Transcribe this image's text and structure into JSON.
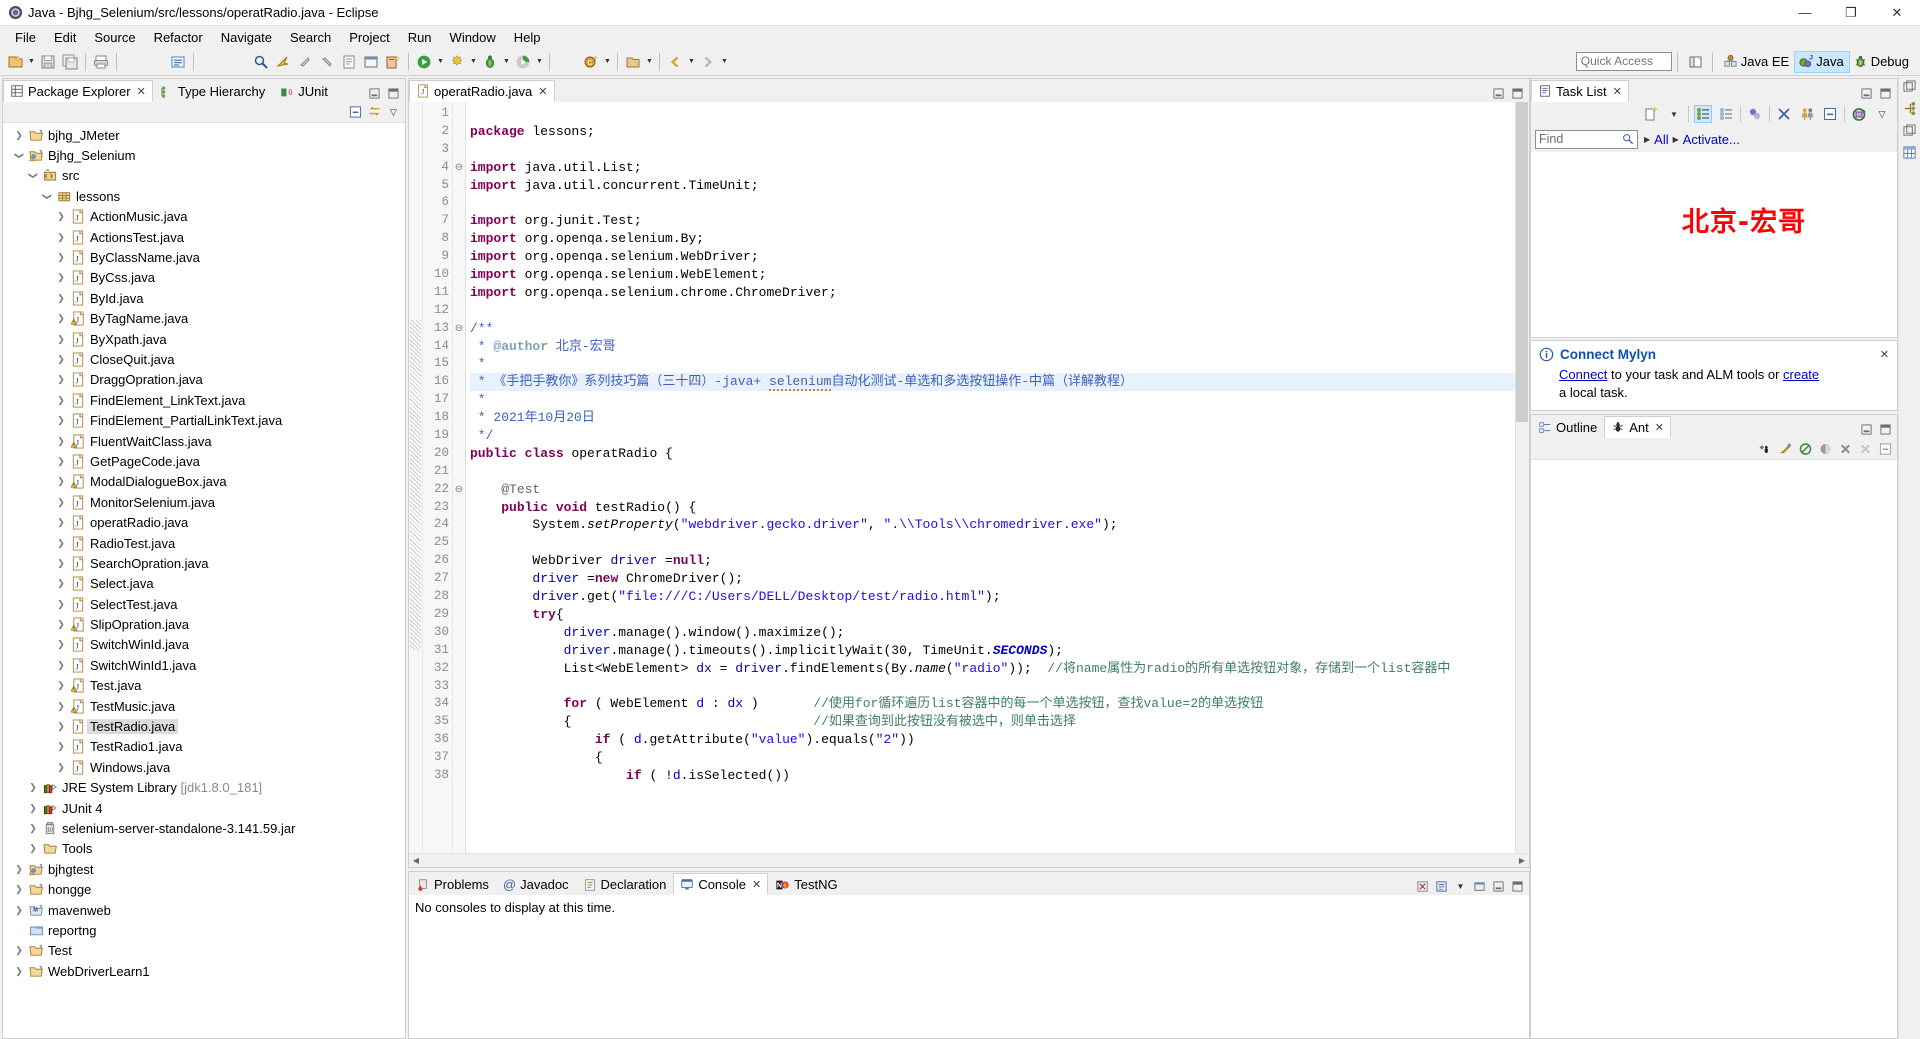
{
  "window": {
    "title": "Java - Bjhg_Selenium/src/lessons/operatRadio.java - Eclipse",
    "minimize": "—",
    "maximize": "❐",
    "close": "✕"
  },
  "menubar": {
    "items": [
      "File",
      "Edit",
      "Source",
      "Refactor",
      "Navigate",
      "Search",
      "Project",
      "Run",
      "Window",
      "Help"
    ]
  },
  "toolbar": {
    "quick_access_placeholder": "Quick Access",
    "perspectives": [
      {
        "label": "Java EE",
        "active": false
      },
      {
        "label": "Java",
        "active": true
      },
      {
        "label": "Debug",
        "active": false
      }
    ]
  },
  "package_explorer": {
    "tabs": [
      {
        "label": "Package Explorer",
        "active": true,
        "closable": true
      },
      {
        "label": "Type Hierarchy",
        "active": false,
        "closable": false
      },
      {
        "label": "JUnit",
        "active": false,
        "closable": false
      }
    ],
    "toolbar_icons": [
      "collapse-all-icon",
      "link-with-editor-icon"
    ],
    "view_menu": "▽",
    "minimize": "—",
    "maximize": "❐",
    "tree": [
      {
        "depth": 0,
        "twisty": "collapsed",
        "icon": "project-closed",
        "label": "bjhg_JMeter"
      },
      {
        "depth": 0,
        "twisty": "expanded",
        "icon": "project-java-warn",
        "label": "Bjhg_Selenium"
      },
      {
        "depth": 1,
        "twisty": "expanded",
        "icon": "source-folder",
        "label": "src"
      },
      {
        "depth": 2,
        "twisty": "expanded",
        "icon": "package",
        "label": "lessons"
      },
      {
        "depth": 3,
        "twisty": "collapsed",
        "icon": "java-file",
        "label": "ActionMusic.java"
      },
      {
        "depth": 3,
        "twisty": "collapsed",
        "icon": "java-file",
        "label": "ActionsTest.java"
      },
      {
        "depth": 3,
        "twisty": "collapsed",
        "icon": "java-file",
        "label": "ByClassName.java"
      },
      {
        "depth": 3,
        "twisty": "collapsed",
        "icon": "java-file",
        "label": "ByCss.java"
      },
      {
        "depth": 3,
        "twisty": "collapsed",
        "icon": "java-file",
        "label": "ById.java"
      },
      {
        "depth": 3,
        "twisty": "collapsed",
        "icon": "java-file-warn",
        "label": "ByTagName.java"
      },
      {
        "depth": 3,
        "twisty": "collapsed",
        "icon": "java-file",
        "label": "ByXpath.java"
      },
      {
        "depth": 3,
        "twisty": "collapsed",
        "icon": "java-file",
        "label": "CloseQuit.java"
      },
      {
        "depth": 3,
        "twisty": "collapsed",
        "icon": "java-file",
        "label": "DraggOpration.java"
      },
      {
        "depth": 3,
        "twisty": "collapsed",
        "icon": "java-file",
        "label": "FindElement_LinkText.java"
      },
      {
        "depth": 3,
        "twisty": "collapsed",
        "icon": "java-file",
        "label": "FindElement_PartialLinkText.java"
      },
      {
        "depth": 3,
        "twisty": "collapsed",
        "icon": "java-file-warn",
        "label": "FluentWaitClass.java"
      },
      {
        "depth": 3,
        "twisty": "collapsed",
        "icon": "java-file",
        "label": "GetPageCode.java"
      },
      {
        "depth": 3,
        "twisty": "collapsed",
        "icon": "java-file-warn",
        "label": "ModalDialogueBox.java"
      },
      {
        "depth": 3,
        "twisty": "collapsed",
        "icon": "java-file",
        "label": "MonitorSelenium.java"
      },
      {
        "depth": 3,
        "twisty": "collapsed",
        "icon": "java-file",
        "label": "operatRadio.java"
      },
      {
        "depth": 3,
        "twisty": "collapsed",
        "icon": "java-file",
        "label": "RadioTest.java"
      },
      {
        "depth": 3,
        "twisty": "collapsed",
        "icon": "java-file",
        "label": "SearchOpration.java"
      },
      {
        "depth": 3,
        "twisty": "collapsed",
        "icon": "java-file",
        "label": "Select.java"
      },
      {
        "depth": 3,
        "twisty": "collapsed",
        "icon": "java-file",
        "label": "SelectTest.java"
      },
      {
        "depth": 3,
        "twisty": "collapsed",
        "icon": "java-file-warn",
        "label": "SlipOpration.java"
      },
      {
        "depth": 3,
        "twisty": "collapsed",
        "icon": "java-file",
        "label": "SwitchWinId.java"
      },
      {
        "depth": 3,
        "twisty": "collapsed",
        "icon": "java-file",
        "label": "SwitchWinId1.java"
      },
      {
        "depth": 3,
        "twisty": "collapsed",
        "icon": "java-file-warn",
        "label": "Test.java"
      },
      {
        "depth": 3,
        "twisty": "collapsed",
        "icon": "java-file-warn",
        "label": "TestMusic.java"
      },
      {
        "depth": 3,
        "twisty": "collapsed",
        "icon": "java-file",
        "label": "TestRadio.java",
        "selected": true
      },
      {
        "depth": 3,
        "twisty": "collapsed",
        "icon": "java-file",
        "label": "TestRadio1.java"
      },
      {
        "depth": 3,
        "twisty": "collapsed",
        "icon": "java-file",
        "label": "Windows.java"
      },
      {
        "depth": 1,
        "twisty": "collapsed",
        "icon": "library",
        "label": "JRE System Library",
        "suffix": "[jdk1.8.0_181]"
      },
      {
        "depth": 1,
        "twisty": "collapsed",
        "icon": "library",
        "label": "JUnit 4"
      },
      {
        "depth": 1,
        "twisty": "collapsed",
        "icon": "jar",
        "label": "selenium-server-standalone-3.141.59.jar"
      },
      {
        "depth": 1,
        "twisty": "collapsed",
        "icon": "folder",
        "label": "Tools"
      },
      {
        "depth": 0,
        "twisty": "collapsed",
        "icon": "project-java-warn",
        "label": "bjhgtest"
      },
      {
        "depth": 0,
        "twisty": "collapsed",
        "icon": "project-closed",
        "label": "hongge"
      },
      {
        "depth": 0,
        "twisty": "collapsed",
        "icon": "project-maven",
        "label": "mavenweb"
      },
      {
        "depth": 0,
        "twisty": "none",
        "icon": "folder-plain",
        "label": "reportng"
      },
      {
        "depth": 0,
        "twisty": "collapsed",
        "icon": "project-closed",
        "label": "Test"
      },
      {
        "depth": 0,
        "twisty": "collapsed",
        "icon": "project-closed",
        "label": "WebDriverLearn1"
      }
    ]
  },
  "editor": {
    "tab": {
      "label": "operatRadio.java",
      "icon": "java-file",
      "close": "✕",
      "active": true
    },
    "minimize": "—",
    "maximize": "❐",
    "lines": [
      {
        "n": 1,
        "fold": "",
        "text": ""
      },
      {
        "n": 2,
        "fold": "",
        "text": "package lessons;"
      },
      {
        "n": 3,
        "fold": "",
        "text": ""
      },
      {
        "n": 4,
        "fold": "⊖",
        "text": "import java.util.List;"
      },
      {
        "n": 5,
        "fold": "",
        "text": "import java.util.concurrent.TimeUnit;"
      },
      {
        "n": 6,
        "fold": "",
        "text": ""
      },
      {
        "n": 7,
        "fold": "",
        "text": "import org.junit.Test;"
      },
      {
        "n": 8,
        "fold": "",
        "text": "import org.openqa.selenium.By;"
      },
      {
        "n": 9,
        "fold": "",
        "text": "import org.openqa.selenium.WebDriver;"
      },
      {
        "n": 10,
        "fold": "",
        "text": "import org.openqa.selenium.WebElement;"
      },
      {
        "n": 11,
        "fold": "",
        "text": "import org.openqa.selenium.chrome.ChromeDriver;"
      },
      {
        "n": 12,
        "fold": "",
        "text": ""
      },
      {
        "n": 13,
        "fold": "⊖",
        "text": "/**"
      },
      {
        "n": 14,
        "fold": "",
        "text": " * @author 北京-宏哥"
      },
      {
        "n": 15,
        "fold": "",
        "text": " *"
      },
      {
        "n": 16,
        "fold": "",
        "text": " * 《手把手教你》系列技巧篇（三十四）-java+ selenium自动化测试-单选和多选按钮操作-中篇（详解教程）",
        "highlight": true
      },
      {
        "n": 17,
        "fold": "",
        "text": " *"
      },
      {
        "n": 18,
        "fold": "",
        "text": " * 2021年10月20日"
      },
      {
        "n": 19,
        "fold": "",
        "text": " */"
      },
      {
        "n": 20,
        "fold": "",
        "text": "public class operatRadio {"
      },
      {
        "n": 21,
        "fold": "",
        "text": ""
      },
      {
        "n": 22,
        "fold": "⊖",
        "text": "    @Test"
      },
      {
        "n": 23,
        "fold": "",
        "text": "    public void testRadio() {"
      },
      {
        "n": 24,
        "fold": "",
        "text": "        System.setProperty(\"webdriver.gecko.driver\", \".\\\\Tools\\\\chromedriver.exe\");"
      },
      {
        "n": 25,
        "fold": "",
        "text": ""
      },
      {
        "n": 26,
        "fold": "",
        "text": "        WebDriver driver =null;"
      },
      {
        "n": 27,
        "fold": "",
        "text": "        driver =new ChromeDriver();"
      },
      {
        "n": 28,
        "fold": "",
        "text": "        driver.get(\"file:///C:/Users/DELL/Desktop/test/radio.html\");"
      },
      {
        "n": 29,
        "fold": "",
        "text": "        try{"
      },
      {
        "n": 30,
        "fold": "",
        "text": "            driver.manage().window().maximize();"
      },
      {
        "n": 31,
        "fold": "",
        "text": "            driver.manage().timeouts().implicitlyWait(30, TimeUnit.SECONDS);"
      },
      {
        "n": 32,
        "fold": "",
        "text": "            List<WebElement> dx = driver.findElements(By.name(\"radio\"));  //将name属性为radio的所有单选按钮对象，存储到一个list容器中"
      },
      {
        "n": 33,
        "fold": "",
        "text": ""
      },
      {
        "n": 34,
        "fold": "",
        "text": "            for ( WebElement d : dx )       //使用for循环遍历list容器中的每一个单选按钮，查找value=2的单选按钮"
      },
      {
        "n": 35,
        "fold": "",
        "text": "            {                               //如果查询到此按钮没有被选中，则单击选择"
      },
      {
        "n": 36,
        "fold": "",
        "text": "                if ( d.getAttribute(\"value\").equals(\"2\"))"
      },
      {
        "n": 37,
        "fold": "",
        "text": "                {"
      },
      {
        "n": 38,
        "fold": "",
        "text": "                    if ( !d.isSelected())"
      }
    ]
  },
  "bottom_panel": {
    "tabs": [
      {
        "label": "Problems",
        "icon": "problems-icon",
        "active": false
      },
      {
        "label": "Javadoc",
        "icon": "javadoc-icon",
        "active": false
      },
      {
        "label": "Declaration",
        "icon": "declaration-icon",
        "active": false
      },
      {
        "label": "Console",
        "icon": "console-icon",
        "active": true,
        "close": "✕"
      },
      {
        "label": "TestNG",
        "icon": "testng-icon",
        "active": false
      }
    ],
    "content": "No consoles to display at this time.",
    "minimize": "—",
    "maximize": "❐"
  },
  "task_list": {
    "tab": {
      "label": "Task List",
      "icon": "tasklist-icon",
      "close": "✕"
    },
    "minimize": "—",
    "maximize": "❐",
    "find_placeholder": "Find",
    "breadcrumb": [
      {
        "label": "All"
      },
      {
        "label": "Activate..."
      }
    ],
    "watermark": "北京-宏哥",
    "mylyn": {
      "title": "Connect Mylyn",
      "close": "✕",
      "line1_link1": "Connect",
      "line1_mid": " to your task and ALM tools or ",
      "line1_link2": "create",
      "line2": "a local task."
    }
  },
  "outline_panel": {
    "tabs": [
      {
        "label": "Outline",
        "icon": "outline-icon",
        "active": false
      },
      {
        "label": "Ant",
        "icon": "ant-icon",
        "active": true,
        "close": "✕"
      }
    ],
    "minimize": "—",
    "maximize": "❐"
  },
  "colors": {
    "keyword": "#7f0055",
    "string": "#2a00ff",
    "comment": "#3f7f5f",
    "javadoc": "#3f5fbf",
    "watermark": "#ff0000",
    "link": "#0000c8",
    "selection": "#e8f2fe"
  }
}
